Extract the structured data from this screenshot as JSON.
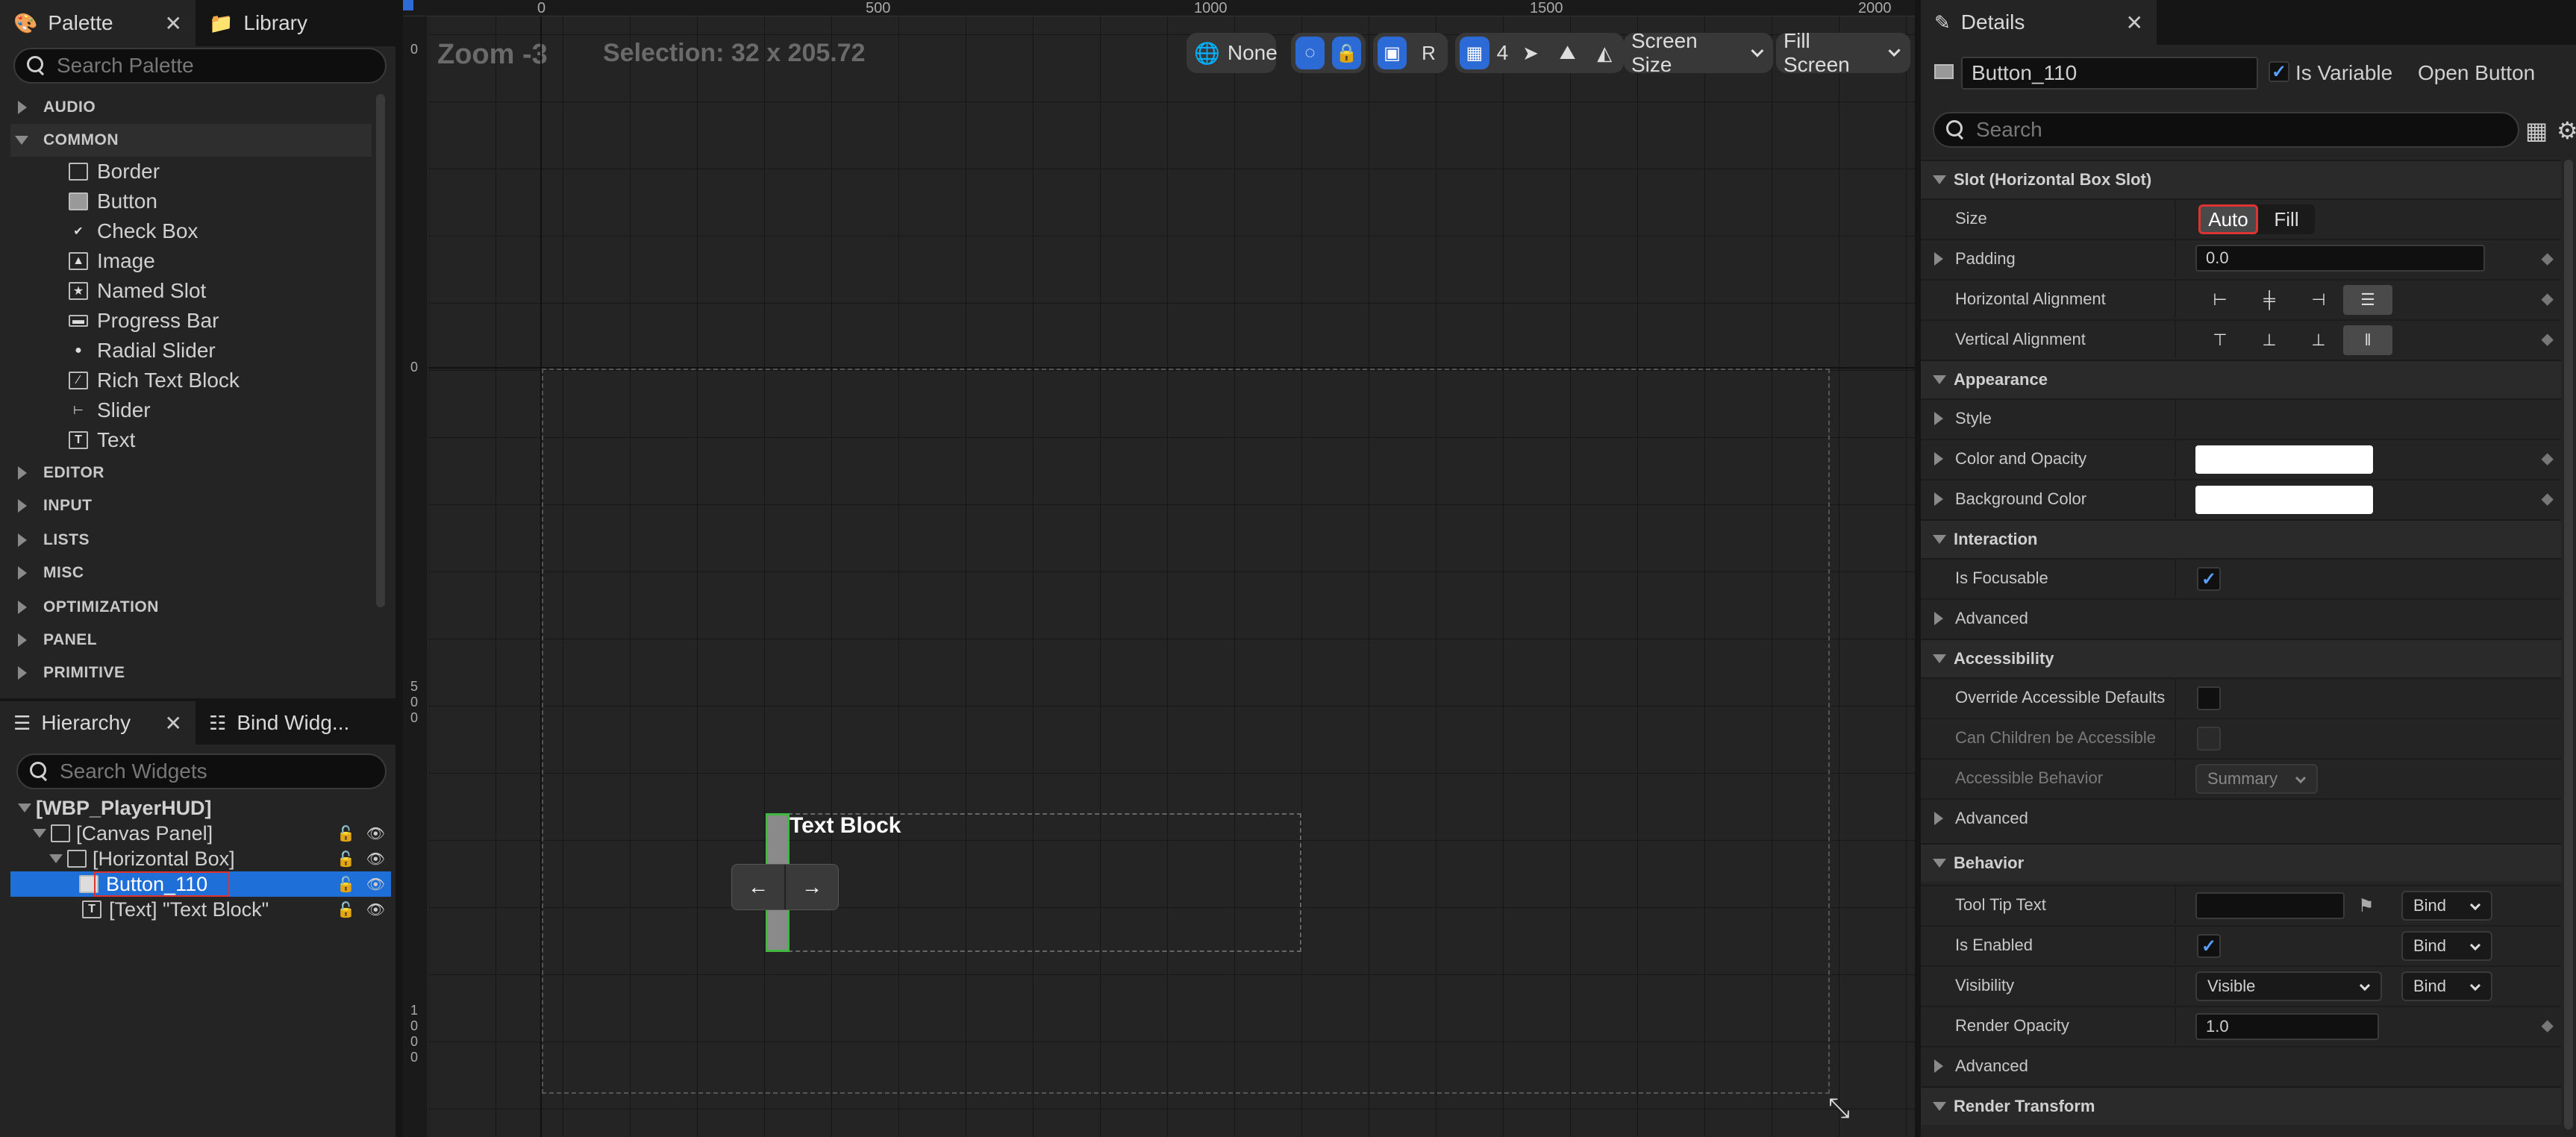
{
  "palette": {
    "tabs": [
      {
        "label": "Palette"
      },
      {
        "label": "Library"
      }
    ],
    "search_placeholder": "Search Palette",
    "categories": [
      "AUDIO",
      "COMMON",
      "EDITOR",
      "INPUT",
      "LISTS",
      "MISC",
      "OPTIMIZATION",
      "PANEL",
      "PRIMITIVE"
    ],
    "common_items": [
      "Border",
      "Button",
      "Check Box",
      "Image",
      "Named Slot",
      "Progress Bar",
      "Radial Slider",
      "Rich Text Block",
      "Slider",
      "Text"
    ]
  },
  "hierarchy": {
    "tabs": [
      {
        "label": "Hierarchy"
      },
      {
        "label": "Bind Widg..."
      }
    ],
    "search_placeholder": "Search Widgets",
    "rows": [
      "[WBP_PlayerHUD]",
      "[Canvas Panel]",
      "[Horizontal Box]",
      "Button_110",
      "[Text] \"Text Block\""
    ]
  },
  "canvas": {
    "zoom": "Zoom -3",
    "selection": "Selection: 32 x 205.72",
    "ruler_top": [
      "0",
      "500",
      "1000",
      "1500",
      "2000"
    ],
    "ruler_left": [
      "0",
      "0",
      "5\n0\n0",
      "1\n0\n0\n0"
    ],
    "toolbar": {
      "localize": "None",
      "reflect": "R",
      "grid_size": "4",
      "screen_size": "Screen Size",
      "fill_screen": "Fill Screen"
    },
    "text_block_label": "Text Block",
    "arrow_left": "←",
    "arrow_right": "→"
  },
  "details": {
    "title": "Details",
    "widget_name": "Button_110",
    "is_variable": "Is Variable",
    "open_button": "Open Button",
    "search_placeholder": "Search",
    "sections": {
      "slot": "Slot (Horizontal Box Slot)",
      "appearance": "Appearance",
      "interaction": "Interaction",
      "accessibility": "Accessibility",
      "behavior": "Behavior",
      "render_transform": "Render Transform"
    },
    "props": {
      "size": "Size",
      "size_auto": "Auto",
      "size_fill": "Fill",
      "padding": "Padding",
      "padding_value": "0.0",
      "halign": "Horizontal Alignment",
      "valign": "Vertical Alignment",
      "style": "Style",
      "color_opacity": "Color and Opacity",
      "background_color": "Background Color",
      "is_focusable": "Is Focusable",
      "advanced": "Advanced",
      "override_access": "Override Accessible Defaults",
      "children_access": "Can Children be Accessible",
      "access_behavior": "Accessible Behavior",
      "access_behavior_value": "Summary",
      "tooltip": "Tool Tip Text",
      "is_enabled": "Is Enabled",
      "visibility": "Visibility",
      "visibility_value": "Visible",
      "render_opacity": "Render Opacity",
      "render_opacity_value": "1.0",
      "bind": "Bind"
    }
  }
}
